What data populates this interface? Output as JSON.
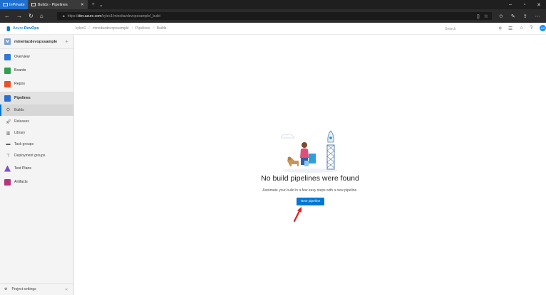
{
  "browser": {
    "inprivate_label": "InPrivate",
    "tab_title": "Builds - Pipelines",
    "url_prefix": "https://",
    "url_domain": "dev.azure.com",
    "url_path": "/kyleo1/mineitazdevopssample/_build"
  },
  "header": {
    "brand_prefix": "Azure ",
    "brand_name": "DevOps",
    "breadcrumbs": [
      "kyleo1",
      "mineitazdevopssample",
      "Pipelines",
      "Builds"
    ],
    "search_placeholder": "Search",
    "avatar_initials": "KO"
  },
  "sidebar": {
    "project_initial": "M",
    "project_name": "mineitazdevopssample",
    "items": [
      {
        "label": "Overview",
        "color": "#2d7ad6"
      },
      {
        "label": "Boards",
        "color": "#2f9e4f"
      },
      {
        "label": "Repos",
        "color": "#e8502b"
      },
      {
        "label": "Pipelines",
        "color": "#2a6fd1"
      },
      {
        "label": "Test Plans",
        "color": "#7b4fc9"
      },
      {
        "label": "Artifacts",
        "color": "#b8357a"
      }
    ],
    "pipeline_sub": [
      "Builds",
      "Releases",
      "Library",
      "Task groups",
      "Deployment groups"
    ],
    "footer_label": "Project settings"
  },
  "main": {
    "empty_title": "No build pipelines were found",
    "empty_subtitle": "Automate your build in a few easy steps with a new pipeline.",
    "new_pipeline_label": "New pipeline"
  },
  "colors": {
    "accent": "#0078d4",
    "annotation_arrow": "#e01e1e"
  }
}
